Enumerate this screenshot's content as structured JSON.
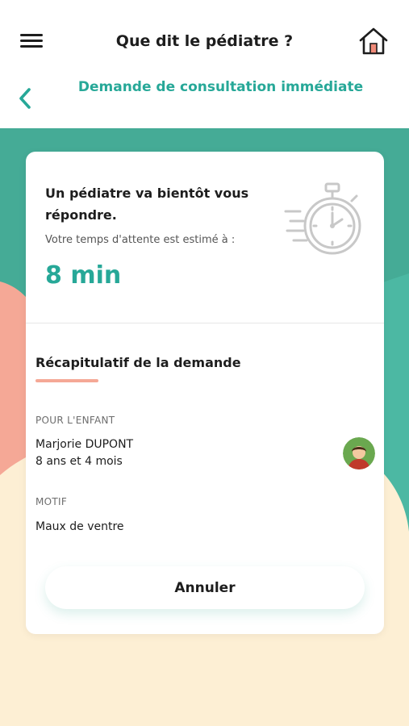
{
  "header": {
    "title": "Que dit le pédiatre ?",
    "menu_icon": "hamburger-menu-icon",
    "home_icon": "home-icon"
  },
  "subheader": {
    "back_icon": "chevron-left-icon",
    "title": "Demande de consultation immédiate"
  },
  "wait": {
    "title": "Un pédiatre va bientôt vous répondre.",
    "subtitle": "Votre temps d'attente est estimé à :",
    "time": "8 min",
    "icon": "stopwatch-icon"
  },
  "recap": {
    "title": "Récapitulatif de la demande",
    "child_label": "POUR L'ENFANT",
    "child_name": "Marjorie DUPONT",
    "child_age": "8 ans et 4 mois",
    "reason_label": "MOTIF",
    "reason": "Maux de ventre",
    "avatar_icon": "child-avatar-icon"
  },
  "actions": {
    "cancel_label": "Annuler"
  },
  "colors": {
    "accent": "#27a898",
    "teal_bg": "#4cb8a3",
    "salmon": "#f5a896",
    "cream": "#fdefd4",
    "battery": "#2ecc71"
  }
}
